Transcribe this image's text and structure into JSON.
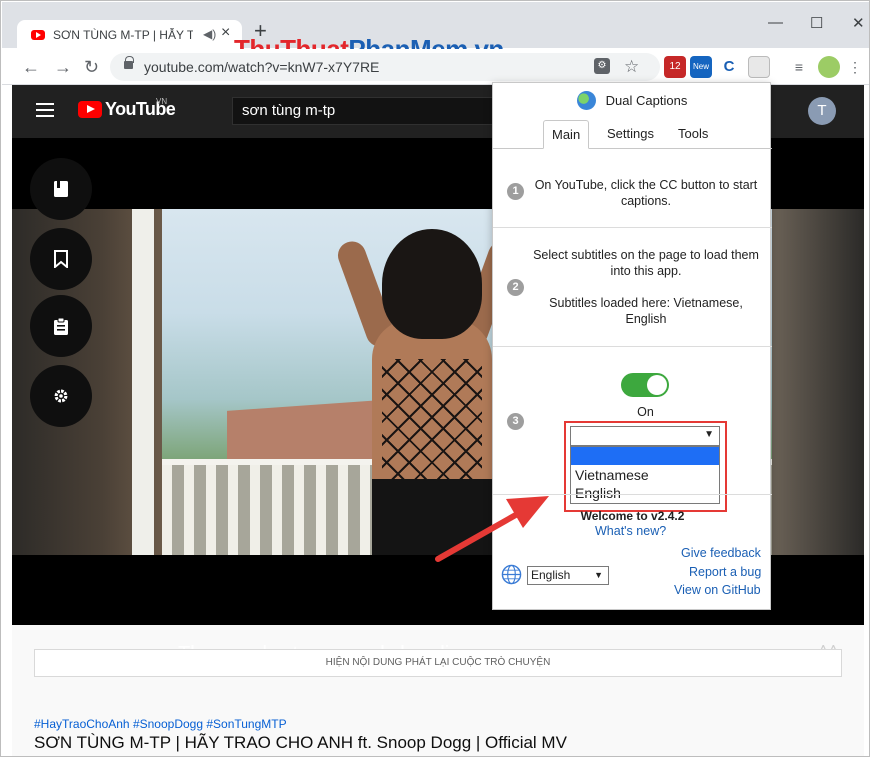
{
  "browser": {
    "tab_title": "SƠN TÙNG M-TP | HẪY TRAO",
    "new_tab_symbol": "+",
    "url": "youtube.com/watch?v=knW7-x7Y7RE",
    "window_controls": {
      "minimize": "—",
      "maximize": "☐",
      "close": "✕"
    },
    "extension_badges": {
      "badge1": "12",
      "badge2": "New",
      "badge3": "C"
    }
  },
  "watermark": {
    "part1": "Thu",
    "part2": "Thuat",
    "part3": "Phan",
    "part4": "Mem",
    "part5": ".vn"
  },
  "youtube": {
    "logo_text": "YouTube",
    "country_code": "VN",
    "search_query": "sơn tùng m-tp",
    "avatar_letter": "T",
    "subtitle_text": "Thousands stars warmly handing",
    "chat_replay_label": "HIỆN NỘI DUNG PHÁT LẠI CUỘC TRÒ CHUYỆN",
    "hashtags": "#HayTraoChoAnh #SnoopDogg #SonTungMTP",
    "video_title": "SƠN TÙNG M-TP | HÃY TRAO CHO ANH ft. Snoop Dogg | Official MV"
  },
  "popup": {
    "title": "Dual Captions",
    "tabs": [
      "Main",
      "Settings",
      "Tools"
    ],
    "active_tab": "Main",
    "step1_num": "1",
    "step1_text": "On YouTube, click the CC button to start captions.",
    "step2_num": "2",
    "step2_text": "Select subtitles on the page to load them into this app.",
    "step2_loaded": "Subtitles loaded here: Vietnamese, English",
    "step3_num": "3",
    "toggle_state": "On",
    "select_value": "",
    "dropdown_options": [
      "",
      "Vietnamese",
      "English"
    ],
    "welcome": "Welcome to v2.4.2",
    "whats_new": "What's new?",
    "give_feedback": "Give feedback",
    "report_bug": "Report a bug",
    "view_github": "View on GitHub",
    "language_value": "English"
  },
  "colors": {
    "toggle_on": "#3da83e",
    "dropdown_highlight": "#1e6ef5",
    "annotation_red": "#e53935",
    "link_blue": "#1a5fb4",
    "yt_red": "#ff0000"
  }
}
